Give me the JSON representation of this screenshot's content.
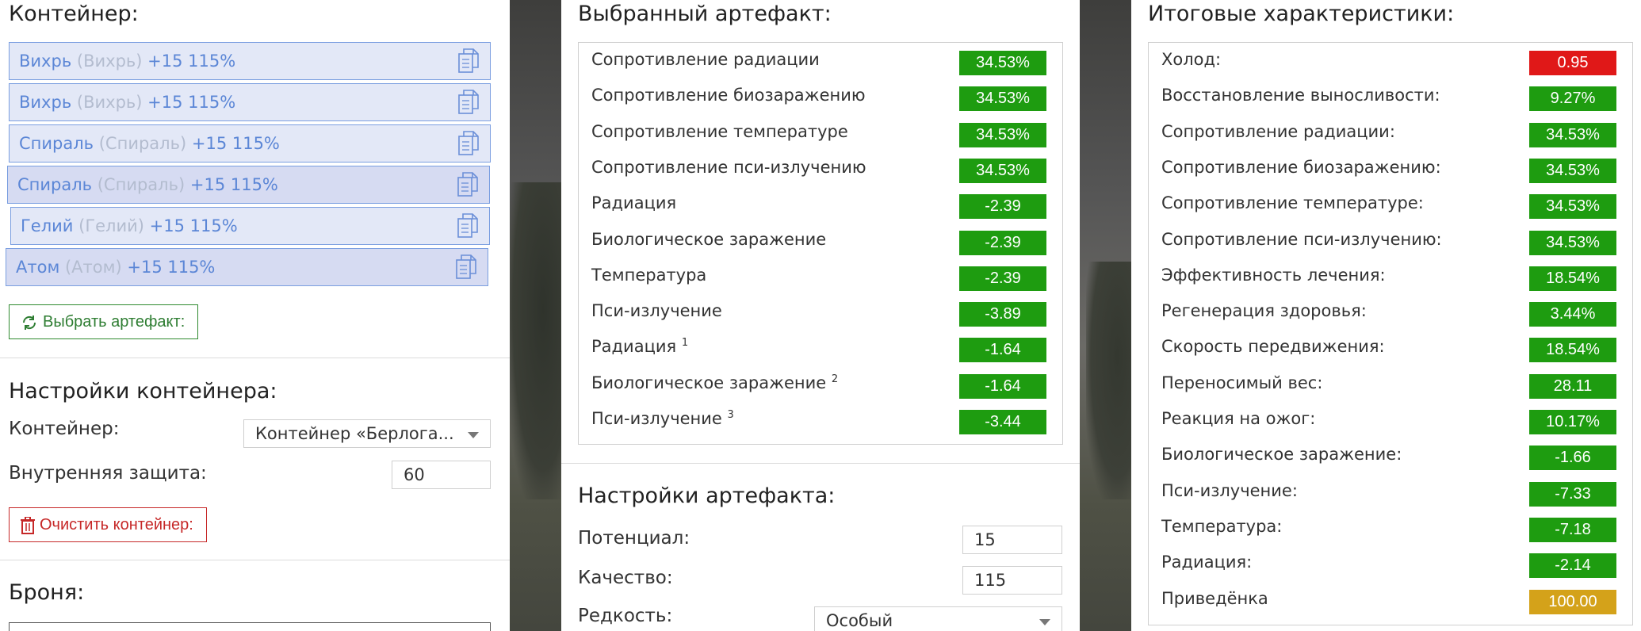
{
  "left": {
    "container_title": "Контейнер:",
    "artifacts": [
      {
        "name": "Вихрь",
        "alias": "(Вихрь)",
        "bonus": "+15 115%"
      },
      {
        "name": "Вихрь",
        "alias": "(Вихрь)",
        "bonus": "+15 115%"
      },
      {
        "name": "Спираль",
        "alias": "(Спираль)",
        "bonus": "+15 115%"
      },
      {
        "name": "Спираль",
        "alias": "(Спираль)",
        "bonus": "+15 115%"
      },
      {
        "name": "Гелий",
        "alias": "(Гелий)",
        "bonus": "+15 115%"
      },
      {
        "name": "Атом",
        "alias": "(Атом)",
        "bonus": "+15 115%"
      }
    ],
    "select_artifact_button": "Выбрать артефакт:",
    "settings_title": "Настройки контейнера:",
    "container_label": "Контейнер:",
    "container_value": "Контейнер «Берлога...",
    "inner_protection_label": "Внутренняя защита:",
    "inner_protection_value": "60",
    "clear_button": "Очистить контейнер:",
    "armor_title": "Броня:"
  },
  "mid": {
    "selected_title": "Выбранный артефакт:",
    "stats": [
      {
        "name": "Сопротивление радиации",
        "sup": "",
        "value": "34.53%",
        "color": "#1e9c10"
      },
      {
        "name": "Сопротивление биозаражению",
        "sup": "",
        "value": "34.53%",
        "color": "#1e9c10"
      },
      {
        "name": "Сопротивление температуре",
        "sup": "",
        "value": "34.53%",
        "color": "#1e9c10"
      },
      {
        "name": "Сопротивление пси-излучению",
        "sup": "",
        "value": "34.53%",
        "color": "#1e9c10"
      },
      {
        "name": "Радиация",
        "sup": "",
        "value": "-2.39",
        "color": "#1e9c10"
      },
      {
        "name": "Биологическое заражение",
        "sup": "",
        "value": "-2.39",
        "color": "#1e9c10"
      },
      {
        "name": "Температура",
        "sup": "",
        "value": "-2.39",
        "color": "#1e9c10"
      },
      {
        "name": "Пси-излучение",
        "sup": "",
        "value": "-3.89",
        "color": "#1e9c10"
      },
      {
        "name": "Радиация",
        "sup": "1",
        "value": "-1.64",
        "color": "#1e9c10"
      },
      {
        "name": "Биологическое заражение",
        "sup": "2",
        "value": "-1.64",
        "color": "#1e9c10"
      },
      {
        "name": "Пси-излучение",
        "sup": "3",
        "value": "-3.44",
        "color": "#1e9c10"
      }
    ],
    "settings_title": "Настройки артефакта:",
    "potential_label": "Потенциал:",
    "potential_value": "15",
    "quality_label": "Качество:",
    "quality_value": "115",
    "rarity_label": "Редкость:",
    "rarity_value": "Особый"
  },
  "right": {
    "title": "Итоговые характеристики:",
    "stats": [
      {
        "name": "Холод:",
        "value": "0.95",
        "color": "#e01818"
      },
      {
        "name": "Восстановление выносливости:",
        "value": "9.27%",
        "color": "#1e9c10"
      },
      {
        "name": "Сопротивление радиации:",
        "value": "34.53%",
        "color": "#1e9c10"
      },
      {
        "name": "Сопротивление биозаражению:",
        "value": "34.53%",
        "color": "#1e9c10"
      },
      {
        "name": "Сопротивление температуре:",
        "value": "34.53%",
        "color": "#1e9c10"
      },
      {
        "name": "Сопротивление пси-излучению:",
        "value": "34.53%",
        "color": "#1e9c10"
      },
      {
        "name": "Эффективность лечения:",
        "value": "18.54%",
        "color": "#1e9c10"
      },
      {
        "name": "Регенерация здоровья:",
        "value": "3.44%",
        "color": "#1e9c10"
      },
      {
        "name": "Скорость передвижения:",
        "value": "18.54%",
        "color": "#1e9c10"
      },
      {
        "name": "Переносимый вес:",
        "value": "28.11",
        "color": "#1e9c10"
      },
      {
        "name": "Реакция на ожог:",
        "value": "10.17%",
        "color": "#1e9c10"
      },
      {
        "name": "Биологическое заражение:",
        "value": "-1.66",
        "color": "#1e9c10"
      },
      {
        "name": "Пси-излучение:",
        "value": "-7.33",
        "color": "#1e9c10"
      },
      {
        "name": "Температура:",
        "value": "-7.18",
        "color": "#1e9c10"
      },
      {
        "name": "Радиация:",
        "value": "-2.14",
        "color": "#1e9c10"
      },
      {
        "name": "Приведёнка",
        "value": "100.00",
        "color": "#d4a21a"
      }
    ]
  }
}
